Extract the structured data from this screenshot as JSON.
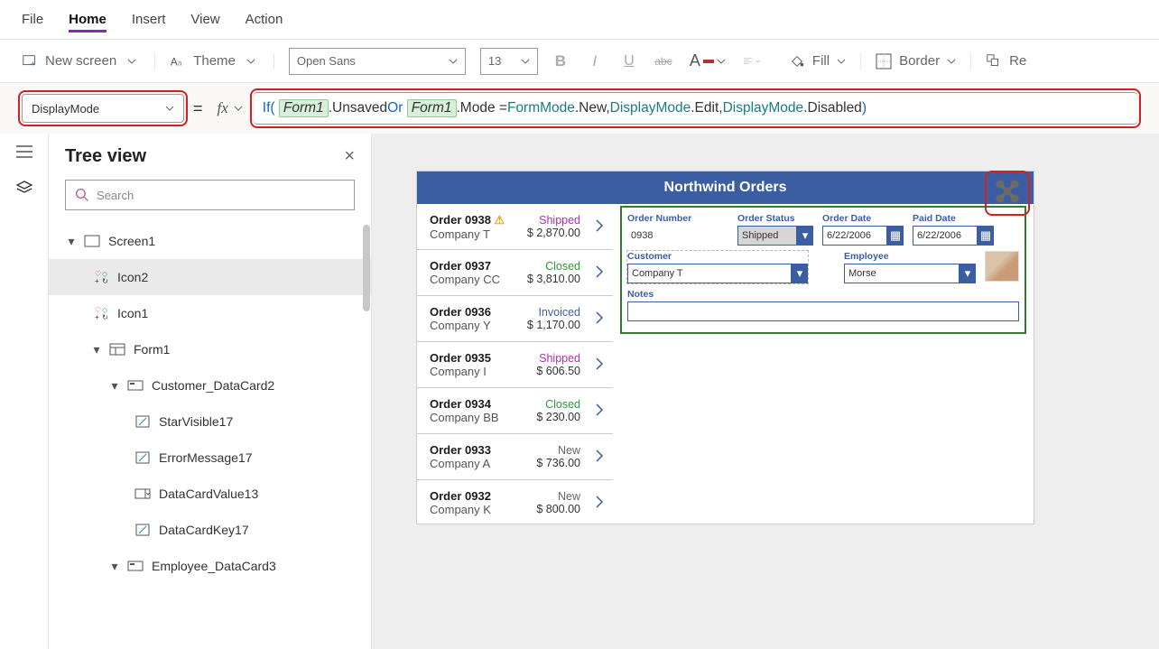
{
  "menu": {
    "file": "File",
    "home": "Home",
    "insert": "Insert",
    "view": "View",
    "action": "Action"
  },
  "ribbon": {
    "new_screen": "New screen",
    "theme": "Theme",
    "font": "Open Sans",
    "fontsize": "13",
    "fill": "Fill",
    "border": "Border",
    "re": "Re"
  },
  "prop_selected": "DisplayMode",
  "formula": {
    "if": "If(",
    "form1": "Form1",
    "unsaved": ".Unsaved ",
    "or": "Or ",
    "mode": ".Mode = ",
    "formmode": "FormMode",
    "new": ".New, ",
    "displaymode": "DisplayMode",
    "edit": ".Edit, ",
    "disabled": ".Disabled ",
    "close": ")"
  },
  "tree": {
    "title": "Tree view",
    "search_placeholder": "Search",
    "screen1": "Screen1",
    "icon2": "Icon2",
    "icon1": "Icon1",
    "form1": "Form1",
    "customer_card": "Customer_DataCard2",
    "starvisible": "StarVisible17",
    "errormsg": "ErrorMessage17",
    "datacardvalue": "DataCardValue13",
    "datacardkey": "DataCardKey17",
    "employee_card": "Employee_DataCard3"
  },
  "app": {
    "title": "Northwind Orders",
    "orders": [
      {
        "id": "Order 0938",
        "company": "Company T",
        "status": "Shipped",
        "statusClass": "st-shipped",
        "amount": "$ 2,870.00",
        "warn": true
      },
      {
        "id": "Order 0937",
        "company": "Company CC",
        "status": "Closed",
        "statusClass": "st-closed",
        "amount": "$ 3,810.00"
      },
      {
        "id": "Order 0936",
        "company": "Company Y",
        "status": "Invoiced",
        "statusClass": "st-invoiced",
        "amount": "$ 1,170.00"
      },
      {
        "id": "Order 0935",
        "company": "Company I",
        "status": "Shipped",
        "statusClass": "st-shipped",
        "amount": "$ 606.50"
      },
      {
        "id": "Order 0934",
        "company": "Company BB",
        "status": "Closed",
        "statusClass": "st-closed",
        "amount": "$ 230.00"
      },
      {
        "id": "Order 0933",
        "company": "Company A",
        "status": "New",
        "statusClass": "st-new",
        "amount": "$ 736.00"
      },
      {
        "id": "Order 0932",
        "company": "Company K",
        "status": "New",
        "statusClass": "st-new",
        "amount": "$ 800.00"
      }
    ],
    "form": {
      "order_number_label": "Order Number",
      "order_number": "0938",
      "order_status_label": "Order Status",
      "order_status": "Shipped",
      "order_date_label": "Order Date",
      "order_date": "6/22/2006",
      "paid_date_label": "Paid Date",
      "paid_date": "6/22/2006",
      "customer_label": "Customer",
      "customer": "Company T",
      "employee_label": "Employee",
      "employee": "Morse",
      "notes_label": "Notes",
      "notes": ""
    }
  }
}
